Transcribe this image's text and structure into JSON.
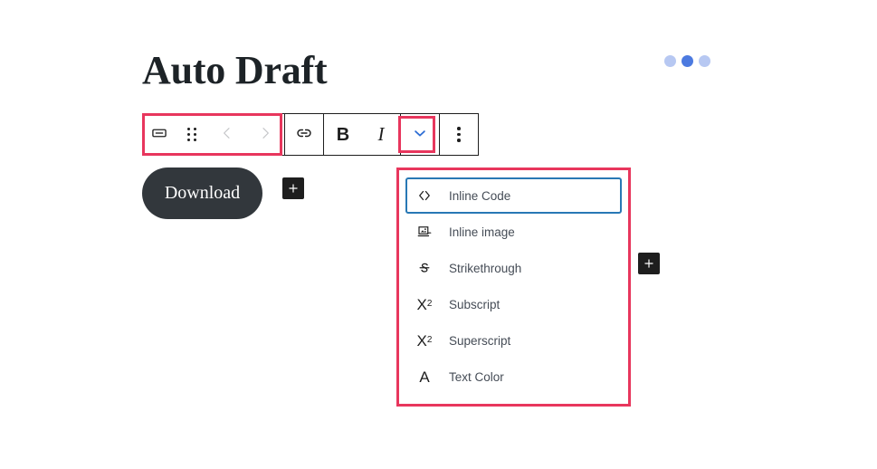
{
  "page": {
    "title": "Auto Draft",
    "background": "#ffffff"
  },
  "loader": {
    "name": "loading-dots",
    "dots": [
      "inactive",
      "active",
      "inactive"
    ],
    "color_active": "#4c7ae0",
    "color_inactive": "#b7c8f2"
  },
  "toolbar": {
    "highlight_color": "#e8365d",
    "groups": [
      {
        "name": "block-controls",
        "items": [
          {
            "name": "block-type-button",
            "icon": "button-block-icon",
            "label": "",
            "disabled": false
          },
          {
            "name": "drag-handle",
            "icon": "drag-handle-icon",
            "label": "",
            "disabled": false
          },
          {
            "name": "move-up-button",
            "icon": "chevron-left-icon",
            "label": "",
            "disabled": true
          },
          {
            "name": "move-down-button",
            "icon": "chevron-right-icon",
            "label": "",
            "disabled": true
          }
        ]
      },
      {
        "name": "link-group",
        "items": [
          {
            "name": "link-button",
            "icon": "link-icon",
            "label": "",
            "disabled": false
          }
        ]
      },
      {
        "name": "format-group",
        "items": [
          {
            "name": "bold-button",
            "icon": "bold-icon",
            "label": "B",
            "disabled": false
          },
          {
            "name": "italic-button",
            "icon": "italic-icon",
            "label": "I",
            "disabled": false
          }
        ]
      },
      {
        "name": "more-formats-group",
        "items": [
          {
            "name": "more-formats-toggle",
            "icon": "chevron-down-icon",
            "label": "",
            "disabled": false,
            "highlighted": true,
            "icon_color": "#2b6cd4"
          }
        ]
      },
      {
        "name": "options-group",
        "items": [
          {
            "name": "block-options-button",
            "icon": "more-vertical-icon",
            "label": "",
            "disabled": false
          }
        ]
      }
    ]
  },
  "content": {
    "download_button": {
      "label": "Download",
      "background": "#32373c",
      "text_color": "#ffffff"
    },
    "inline_inserter_label": "+",
    "appender_label": "+"
  },
  "dropdown": {
    "highlight_color": "#e8365d",
    "focus_color": "#2878b5",
    "items": [
      {
        "icon": "inline-code-icon",
        "label": "Inline Code",
        "focused": true
      },
      {
        "icon": "inline-image-icon",
        "label": "Inline image",
        "focused": false
      },
      {
        "icon": "strikethrough-icon",
        "label": "Strikethrough",
        "focused": false
      },
      {
        "icon": "subscript-icon",
        "label": "Subscript",
        "focused": false
      },
      {
        "icon": "superscript-icon",
        "label": "Superscript",
        "focused": false
      },
      {
        "icon": "text-color-icon",
        "label": "Text Color",
        "focused": false
      }
    ]
  }
}
